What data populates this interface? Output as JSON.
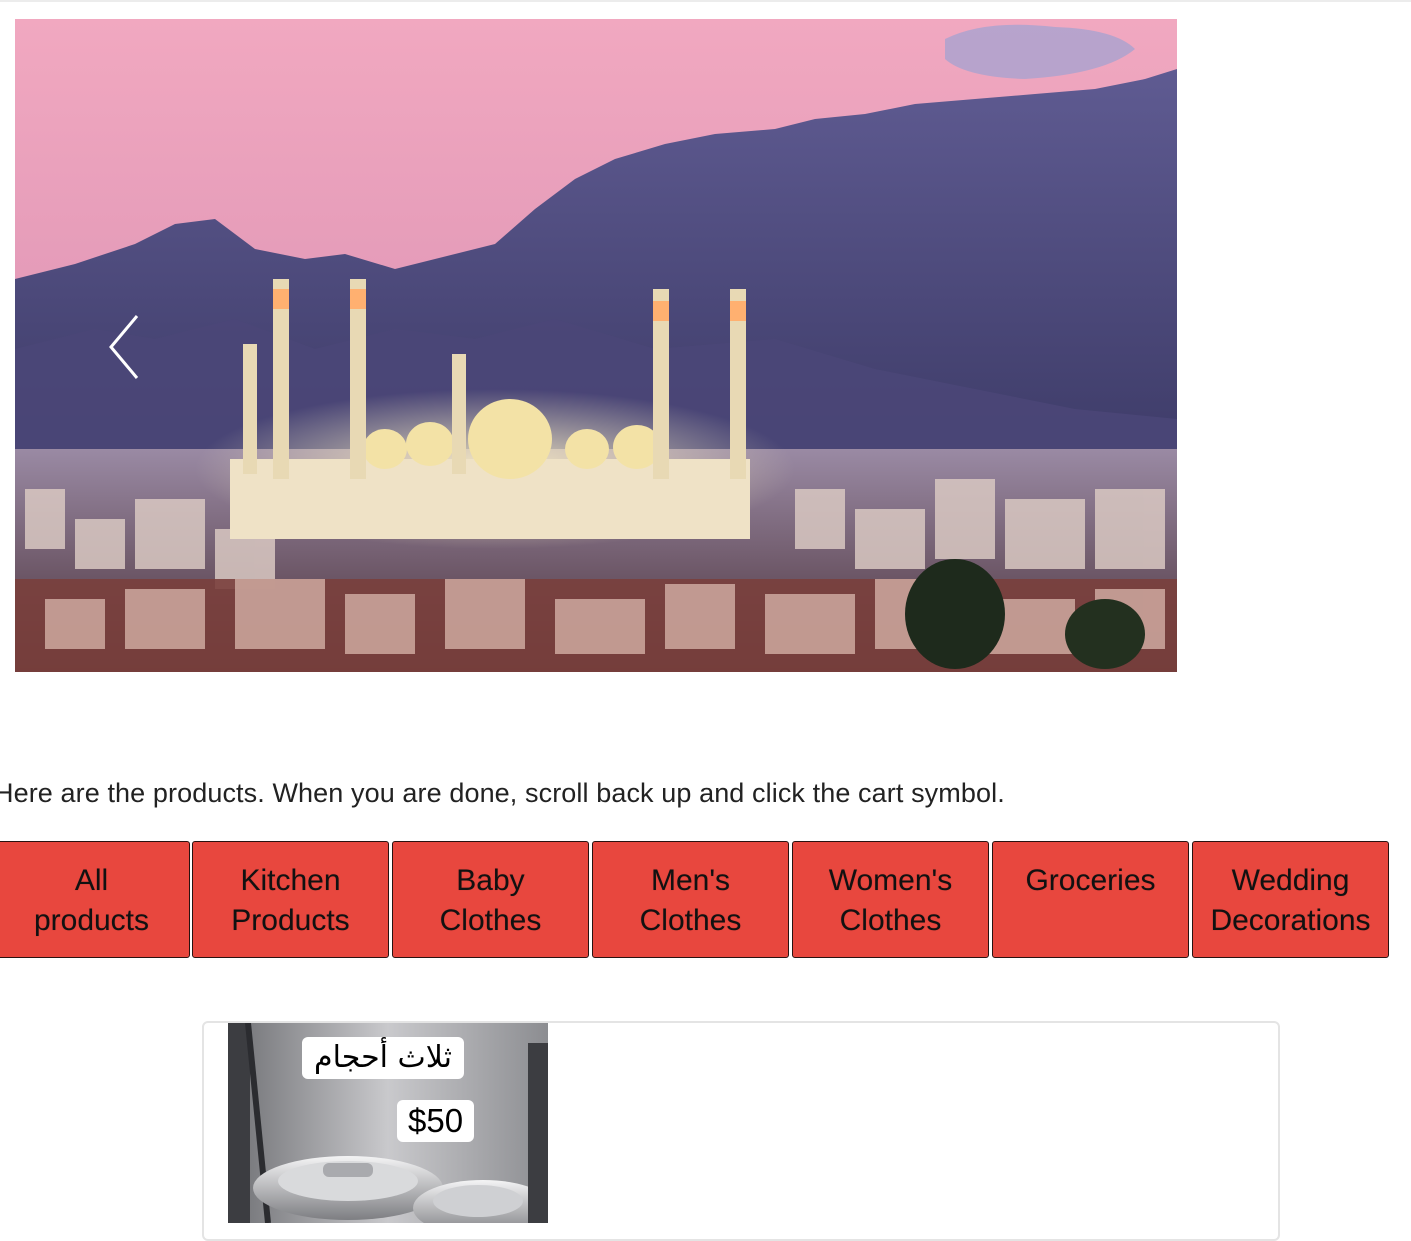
{
  "carousel": {
    "image_name": "sanaa-mosque-photo",
    "prev_icon": "chevron-left-icon"
  },
  "intro_text": "Here are the products. When you are done, scroll back up and click the cart symbol.",
  "categories": [
    {
      "line1": "All",
      "line2": "products"
    },
    {
      "line1": "Kitchen",
      "line2": "Products"
    },
    {
      "line1": "Baby",
      "line2": "Clothes"
    },
    {
      "line1": "Men's",
      "line2": "Clothes"
    },
    {
      "line1": "Women's",
      "line2": "Clothes"
    },
    {
      "line1": "Groceries",
      "line2": ""
    },
    {
      "line1": "Wedding",
      "line2": "Decorations"
    }
  ],
  "colors": {
    "category_button": "#e8473e",
    "category_border": "#2a1210"
  },
  "product": {
    "label_arabic": "ثلاث أحجام",
    "price": "$50"
  }
}
